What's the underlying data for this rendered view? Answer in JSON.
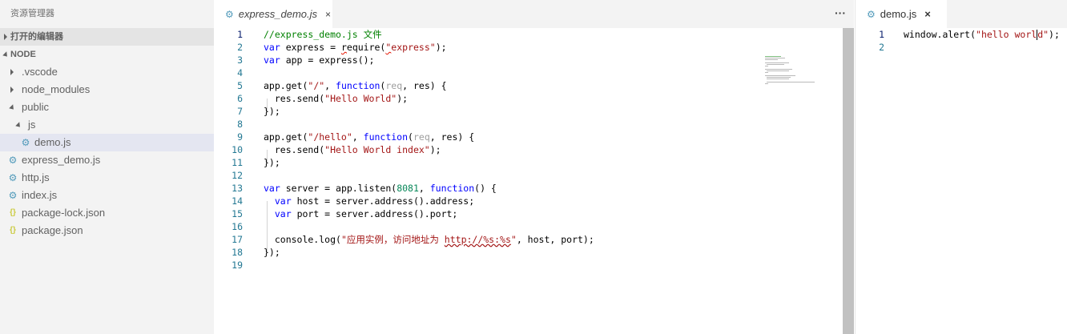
{
  "sidebar": {
    "title": "资源管理器",
    "open_editors_label": "打开的编辑器",
    "folder_label": "NODE",
    "items": [
      {
        "label": ".vscode",
        "type": "folder",
        "depth": 1,
        "expanded": false
      },
      {
        "label": "node_modules",
        "type": "folder",
        "depth": 1,
        "expanded": false
      },
      {
        "label": "public",
        "type": "folder",
        "depth": 1,
        "expanded": true
      },
      {
        "label": "js",
        "type": "folder",
        "depth": 2,
        "expanded": true
      },
      {
        "label": "demo.js",
        "type": "js",
        "depth": 3,
        "selected": true
      },
      {
        "label": "express_demo.js",
        "type": "js",
        "depth": 1
      },
      {
        "label": "http.js",
        "type": "js",
        "depth": 1
      },
      {
        "label": "index.js",
        "type": "js",
        "depth": 1
      },
      {
        "label": "package-lock.json",
        "type": "json",
        "depth": 1
      },
      {
        "label": "package.json",
        "type": "json",
        "depth": 1
      }
    ]
  },
  "editor1": {
    "tab_label": "express_demo.js",
    "tab_close": "×",
    "more": "···",
    "line_numbers": [
      "1",
      "2",
      "3",
      "4",
      "5",
      "6",
      "7",
      "8",
      "9",
      "10",
      "11",
      "12",
      "13",
      "14",
      "15",
      "16",
      "17",
      "18",
      "19"
    ],
    "current_line": 1
  },
  "editor2": {
    "tab_label": "demo.js",
    "tab_close": "×",
    "line_numbers": [
      "1",
      "2"
    ],
    "current_line": 1
  },
  "colors": {
    "keyword": "#0000ff",
    "string": "#a31515",
    "comment": "#008000",
    "number": "#09885a",
    "line_number": "#237893",
    "sidebar_bg": "#f3f3f3",
    "selected_bg": "#e4e6f1",
    "js_icon": "#519aba",
    "json_icon": "#cbcb41"
  },
  "icons": {
    "js_file": "gear-icon",
    "json_file": "braces-icon",
    "collapsed": "chevron-right-icon",
    "expanded": "chevron-down-icon"
  }
}
